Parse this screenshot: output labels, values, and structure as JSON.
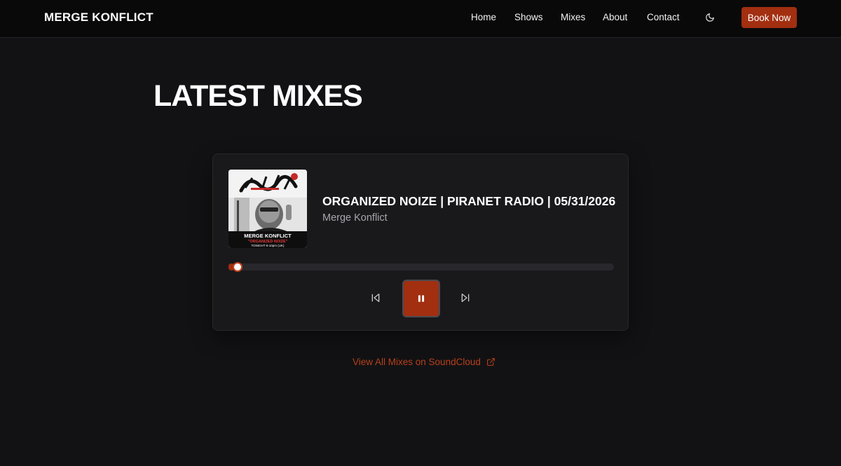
{
  "header": {
    "brand": "MERGE KONFLICT",
    "nav": [
      {
        "label": "Home"
      },
      {
        "label": "Shows"
      },
      {
        "label": "Mixes"
      },
      {
        "label": "About"
      },
      {
        "label": "Contact"
      }
    ],
    "theme_icon": "moon-icon",
    "book_label": "Book Now"
  },
  "section": {
    "title": "LATEST MIXES"
  },
  "player": {
    "artwork_icon": "album-artwork",
    "artwork_text": {
      "name": "MERGE KONFLICT",
      "show": "\"ORGANIZED NOIZE\"",
      "time": "TONIGHT 8-10pm (UK)"
    },
    "track_title": "ORGANIZED NOIZE | PIRANET RADIO | 05/31/2026",
    "artist": "Merge Konflict",
    "progress": 0.015,
    "state": "playing",
    "icons": {
      "prev": "skip-back-icon",
      "pause": "pause-icon",
      "next": "skip-forward-icon"
    }
  },
  "links": {
    "soundcloud_label": "View All Mixes on SoundCloud",
    "soundcloud_icon": "external-link-icon"
  },
  "colors": {
    "accent": "#a22f10",
    "background": "#121214",
    "card": "#19191c",
    "link": "#b8401a"
  }
}
